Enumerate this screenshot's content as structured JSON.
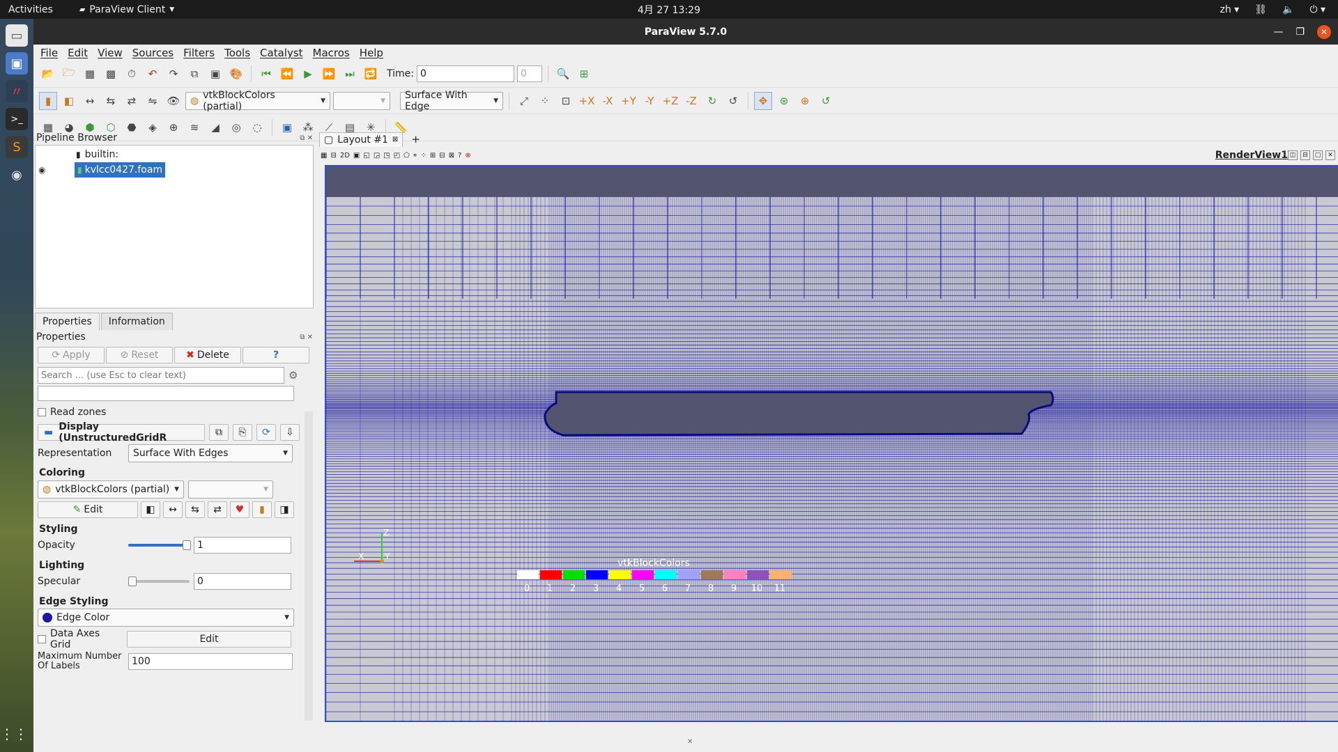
{
  "topbar": {
    "activities": "Activities",
    "app_name": "ParaView Client",
    "clock": "4月 27  13:29",
    "lang": "zh"
  },
  "window": {
    "title": "ParaView 5.7.0"
  },
  "menu": [
    "File",
    "Edit",
    "View",
    "Sources",
    "Filters",
    "Tools",
    "Catalyst",
    "Macros",
    "Help"
  ],
  "toolbar": {
    "time_label": "Time:",
    "time_value": "0",
    "time_step": "0",
    "color_by": "vtkBlockColors (partial)",
    "component": "",
    "representation": "Surface With Edge"
  },
  "pipeline": {
    "title": "Pipeline Browser",
    "items": [
      "builtin:",
      "kvlcc0427.foam"
    ]
  },
  "properties": {
    "tabs": [
      "Properties",
      "Information"
    ],
    "title": "Properties",
    "apply": "Apply",
    "reset": "Reset",
    "delete": "Delete",
    "help": "?",
    "search_placeholder": "Search ... (use Esc to clear text)",
    "read_zones": "Read zones",
    "display_title": "Display (UnstructuredGridR",
    "representation_label": "Representation",
    "representation_value": "Surface With Edges",
    "coloring_title": "Coloring",
    "coloring_value": "vtkBlockColors (partial)",
    "edit": "Edit",
    "styling_title": "Styling",
    "opacity_label": "Opacity",
    "opacity_value": "1",
    "lighting_title": "Lighting",
    "specular_label": "Specular",
    "specular_value": "0",
    "edge_styling_title": "Edge Styling",
    "edge_color": "Edge Color",
    "data_axes_grid": "Data Axes Grid",
    "data_axes_edit": "Edit",
    "max_labels_label": "Maximum Number Of Labels",
    "max_labels_value": "100"
  },
  "layout": {
    "tab": "Layout #1",
    "add": "+",
    "view_name": "RenderView1",
    "view_2d": "2D"
  },
  "render": {
    "legend_title": "vtkBlockColors",
    "legend_labels": [
      "0",
      "1",
      "2",
      "3",
      "4",
      "5",
      "6",
      "7",
      "8",
      "9",
      "10",
      "11"
    ],
    "legend_colors": [
      "#ffffff",
      "#ff0000",
      "#00e000",
      "#0000ff",
      "#ffff00",
      "#ff00ff",
      "#00ffff",
      "#a0a0ff",
      "#a0785a",
      "#ff80c0",
      "#9050c0",
      "#ffb070"
    ],
    "axis_labels": {
      "z": "Z",
      "y": "Y",
      "x": "X"
    }
  },
  "colors": {
    "mesh_line": "#1a1aa0",
    "background": "#525470",
    "selection": "#3072c2"
  }
}
